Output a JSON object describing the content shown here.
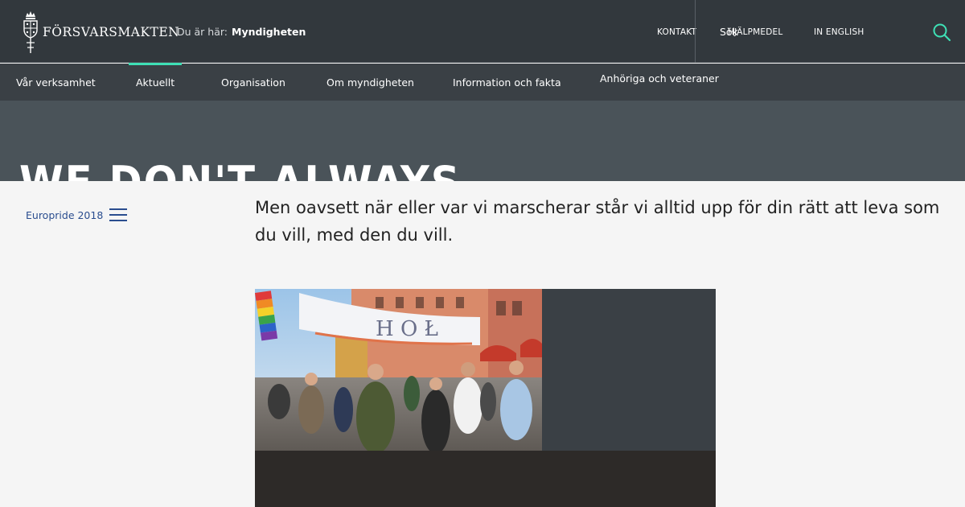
{
  "header": {
    "logo_text": "FÖRSVARSMAKTEN",
    "breadcrumb_label": "Du är här:",
    "breadcrumb_current": "Myndigheten",
    "utility": [
      "KONTAKT",
      "HJÄLPMEDEL",
      "IN ENGLISH"
    ],
    "search_label": "Sök"
  },
  "nav": {
    "items": [
      "Vår verksamhet",
      "Aktuellt",
      "Organisation",
      "Om myndigheten",
      "Information och fakta",
      "Anhöriga och veteraner"
    ]
  },
  "hero": {
    "title": "WE DON'T ALWAYS"
  },
  "content": {
    "side_link": "Europride 2018",
    "lead": "Men oavsett när eller var vi marscherar står vi alltid upp för din rätt att leva som du vill, med den du vill."
  },
  "colors": {
    "header_bg": "#32383d",
    "nav_bg": "#3a4045",
    "accent": "#3ee0b5",
    "link": "#2a4d8f"
  }
}
